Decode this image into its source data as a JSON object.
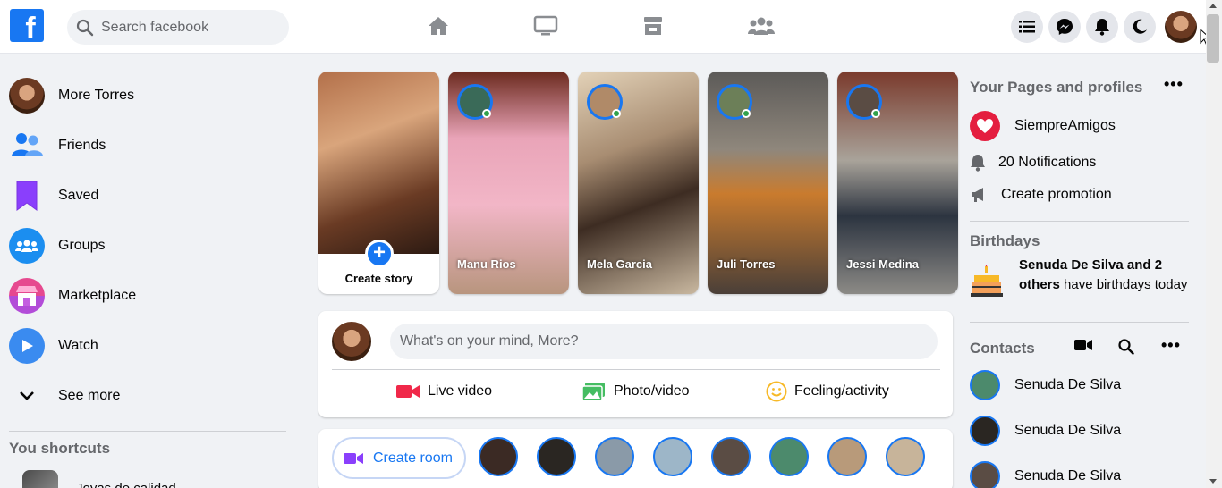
{
  "header": {
    "logo_letter": "f",
    "search_placeholder": "Search facebook",
    "nav_icons": [
      "home-icon",
      "watch-tv-icon",
      "marketplace-store-icon",
      "groups-icon"
    ],
    "right_icons": [
      "menu-list-icon",
      "messenger-icon",
      "notifications-bell-icon",
      "dark-mode-moon-icon"
    ]
  },
  "sidebar": {
    "items": [
      {
        "label": "More Torres",
        "icon": "profile-avatar"
      },
      {
        "label": "Friends",
        "icon": "friends-icon"
      },
      {
        "label": "Saved",
        "icon": "saved-bookmark-icon"
      },
      {
        "label": "Groups",
        "icon": "groups-icon"
      },
      {
        "label": "Marketplace",
        "icon": "marketplace-icon"
      },
      {
        "label": "Watch",
        "icon": "watch-play-icon"
      },
      {
        "label": "See more",
        "icon": "chevron-down-icon"
      }
    ],
    "shortcuts_title": "You shortcuts",
    "shortcut_label": "Joyas de calidad"
  },
  "stories": {
    "create_label": "Create story",
    "items": [
      {
        "name": "Manu Rios",
        "bg": "pink"
      },
      {
        "name": "Mela Garcia",
        "bg": "beige"
      },
      {
        "name": "Juli Torres",
        "bg": "bus"
      },
      {
        "name": "Jessi Medina",
        "bg": "alley"
      }
    ]
  },
  "composer": {
    "placeholder": "What's on your mind, More?",
    "live_label": "Live video",
    "photo_label": "Photo/video",
    "feeling_label": "Feeling/activity"
  },
  "rooms": {
    "create_label": "Create room",
    "avatar_count": 8
  },
  "right": {
    "pages_title": "Your Pages and profiles",
    "page_name": "SiempreAmigos",
    "notifications_label": "20 Notifications",
    "promotion_label": "Create promotion",
    "birthdays_title": "Birthdays",
    "birthday_names": "Senuda De Silva and 2 others",
    "birthday_rest": " have birthdays today",
    "contacts_title": "Contacts",
    "contacts": [
      "Senuda De Silva",
      "Senuda De Silva",
      "Senuda De Silva"
    ]
  },
  "colors": {
    "brand": "#1877f2",
    "live_red": "#f02849",
    "photo_green": "#45bd62",
    "feeling_yellow": "#f7b928"
  }
}
